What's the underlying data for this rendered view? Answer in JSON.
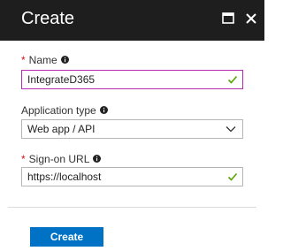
{
  "header": {
    "title": "Create",
    "maximize_icon": "maximize-icon",
    "close_icon": "close-icon",
    "background": "#1e1e1e"
  },
  "form": {
    "name": {
      "required_marker": "*",
      "label": "Name",
      "value": "IntegrateD365",
      "valid": true
    },
    "application_type": {
      "label": "Application type",
      "selected": "Web app / API"
    },
    "sign_on_url": {
      "required_marker": "*",
      "label": "Sign-on URL",
      "value": "https://localhost",
      "valid": true
    }
  },
  "actions": {
    "create_label": "Create"
  },
  "colors": {
    "accent": "#0072c6",
    "required": "#e00b1c",
    "valid_check": "#57a300",
    "focus_border": "#b72cb0"
  }
}
